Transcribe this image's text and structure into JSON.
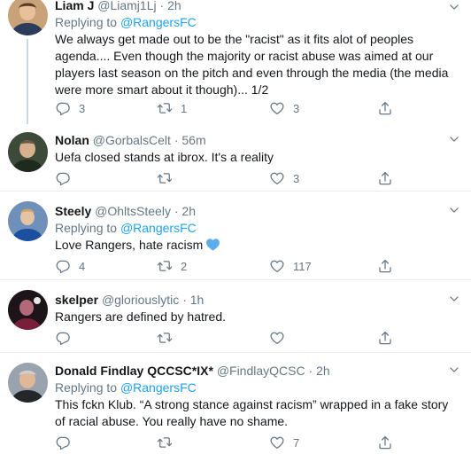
{
  "tweets": [
    {
      "name": "Liam J",
      "handle": "@Liamj1Lj",
      "separator": "·",
      "time": "2h",
      "reply_prefix": "Replying to",
      "reply_mention": "@RangersFC",
      "text": "We always get made out to be the \"racist\" as it fits alot of peoples agenda.... Even though the majority or racist abuse was aimed at our players last season on the pitch and even through the media (the media were more smart about it though)... 1/2",
      "replies": "3",
      "retweets": "1",
      "likes": "3"
    },
    {
      "name": "Nolan",
      "handle": "@GorbalsCelt",
      "separator": "·",
      "time": "56m",
      "text": "Uefa closed stands at ibrox. It's a reality",
      "replies": "",
      "retweets": "",
      "likes": "3"
    },
    {
      "name": "Steely",
      "handle": "@OhltsSteely",
      "separator": "·",
      "time": "2h",
      "reply_prefix": "Replying to",
      "reply_mention": "@RangersFC",
      "text": "Love Rangers, hate racism",
      "emoji": "blue-heart-emoji",
      "replies": "4",
      "retweets": "2",
      "likes": "117"
    },
    {
      "name": "skelper",
      "handle": "@gloriouslytic",
      "separator": "·",
      "time": "1h",
      "text": "Rangers are defined by hatred.",
      "replies": "",
      "retweets": "",
      "likes": ""
    },
    {
      "name": "Donald Findlay QCCSC*IX*",
      "handle": "@FindlayQCSC",
      "separator": "·",
      "time": "2h",
      "reply_prefix": "Replying to",
      "reply_mention": "@RangersFC",
      "text": "This fckn Klub. “A strong stance against racism” wrapped in a fake story of racial abuse. You really have no shame.",
      "replies": "",
      "retweets": "",
      "likes": "7"
    }
  ],
  "colors": {
    "accent": "#1da1f2",
    "muted": "#657786",
    "text": "#14171a",
    "divider": "#e6ecf0",
    "thread_line": "#ccd6dd",
    "heart_emoji": "#5dadec"
  },
  "icons": [
    "reply-icon",
    "retweet-icon",
    "like-icon",
    "share-icon",
    "chevron-down-icon"
  ]
}
